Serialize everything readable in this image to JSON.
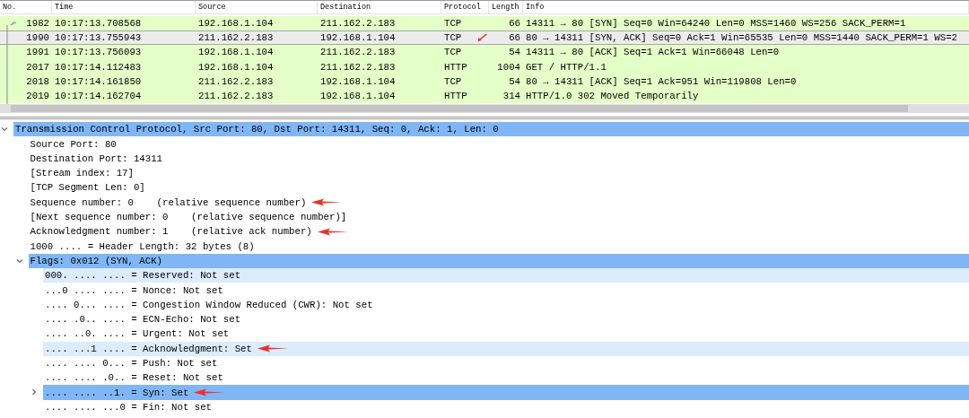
{
  "packet_list": {
    "columns": [
      "No.",
      "Time",
      "Source",
      "Destination",
      "Protocol",
      "Length",
      "Info"
    ],
    "rows": [
      {
        "no": "1982",
        "time": "10:17:13.708568",
        "source": "192.168.1.104",
        "destination": "211.162.2.183",
        "protocol": "TCP",
        "length": "66",
        "info": "14311 → 80 [SYN] Seq=0 Win=64240 Len=0 MSS=1460 WS=256 SACK_PERM=1",
        "selected": false,
        "annotated": false
      },
      {
        "no": "1990",
        "time": "10:17:13.755943",
        "source": "211.162.2.183",
        "destination": "192.168.1.104",
        "protocol": "TCP",
        "length": "66",
        "info": "80 → 14311 [SYN, ACK] Seq=0 Ack=1 Win=65535 Len=0 MSS=1440 SACK_PERM=1 WS=2",
        "selected": true,
        "annotated": true
      },
      {
        "no": "1991",
        "time": "10:17:13.756093",
        "source": "192.168.1.104",
        "destination": "211.162.2.183",
        "protocol": "TCP",
        "length": "54",
        "info": "14311 → 80 [ACK] Seq=1 Ack=1 Win=66048 Len=0",
        "selected": false,
        "annotated": false
      },
      {
        "no": "2017",
        "time": "10:17:14.112483",
        "source": "192.168.1.104",
        "destination": "211.162.2.183",
        "protocol": "HTTP",
        "length": "1004",
        "info": "GET / HTTP/1.1",
        "selected": false,
        "annotated": false
      },
      {
        "no": "2018",
        "time": "10:17:14.161850",
        "source": "211.162.2.183",
        "destination": "192.168.1.104",
        "protocol": "TCP",
        "length": "54",
        "info": "80 → 14311 [ACK] Seq=1 Ack=951 Win=119808 Len=0",
        "selected": false,
        "annotated": false
      },
      {
        "no": "2019",
        "time": "10:17:14.162704",
        "source": "211.162.2.183",
        "destination": "192.168.1.104",
        "protocol": "HTTP",
        "length": "314",
        "info": "HTTP/1.0 302 Moved Temporarily",
        "selected": false,
        "annotated": false
      }
    ]
  },
  "details": [
    {
      "text": "Transmission Control Protocol, Src Port: 80, Dst Port: 14311, Seq: 0, Ack: 1, Len: 0",
      "expanded": true,
      "selected": true,
      "related": false,
      "annotated": false,
      "children": [
        {
          "text": "Source Port: 80",
          "selected": false,
          "related": false,
          "annotated": false
        },
        {
          "text": "Destination Port: 14311",
          "selected": false,
          "related": false,
          "annotated": false
        },
        {
          "text": "[Stream index: 17]",
          "selected": false,
          "related": false,
          "annotated": false
        },
        {
          "text": "[TCP Segment Len: 0]",
          "selected": false,
          "related": false,
          "annotated": false
        },
        {
          "text": "Sequence number: 0    (relative sequence number)",
          "selected": false,
          "related": false,
          "annotated": true
        },
        {
          "text": "[Next sequence number: 0    (relative sequence number)]",
          "selected": false,
          "related": false,
          "annotated": false
        },
        {
          "text": "Acknowledgment number: 1    (relative ack number)",
          "selected": false,
          "related": false,
          "annotated": true
        },
        {
          "text": "1000 .... = Header Length: 32 bytes (8)",
          "selected": false,
          "related": false,
          "annotated": false
        },
        {
          "text": "Flags: 0x012 (SYN, ACK)",
          "expanded": true,
          "selected": true,
          "related": false,
          "annotated": false,
          "children": [
            {
              "text": "000. .... .... = Reserved: Not set",
              "selected": false,
              "related": true,
              "annotated": false
            },
            {
              "text": "...0 .... .... = Nonce: Not set",
              "selected": false,
              "related": false,
              "annotated": false
            },
            {
              "text": ".... 0... .... = Congestion Window Reduced (CWR): Not set",
              "selected": false,
              "related": false,
              "annotated": false
            },
            {
              "text": ".... .0.. .... = ECN-Echo: Not set",
              "selected": false,
              "related": false,
              "annotated": false
            },
            {
              "text": ".... ..0. .... = Urgent: Not set",
              "selected": false,
              "related": false,
              "annotated": false
            },
            {
              "text": ".... ...1 .... = Acknowledgment: Set",
              "selected": false,
              "related": true,
              "annotated": true
            },
            {
              "text": ".... .... 0... = Push: Not set",
              "selected": false,
              "related": false,
              "annotated": false
            },
            {
              "text": ".... .... .0.. = Reset: Not set",
              "selected": false,
              "related": false,
              "annotated": false
            },
            {
              "text": ".... .... ..1. = Syn: Set",
              "expanded": false,
              "selected": true,
              "related": false,
              "annotated": true
            },
            {
              "text": ".... .... ...0 = Fin: Not set",
              "selected": false,
              "related": false,
              "annotated": false
            }
          ]
        }
      ]
    }
  ]
}
